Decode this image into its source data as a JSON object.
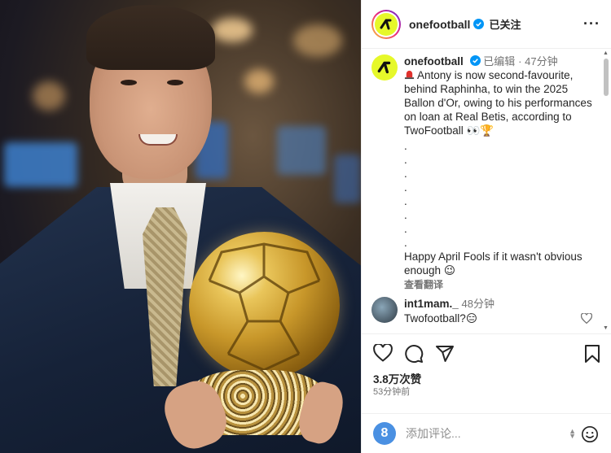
{
  "post": {
    "username": "onefootball",
    "follow_state": "已关注",
    "more": "···"
  },
  "caption": {
    "username": "onefootball",
    "edited": "已编辑",
    "separator": "·",
    "age": "47分钟",
    "text": "Antony is now second-favourite, behind Raphinha, to win the 2025 Ballon d'Or, owing to his performances on loan at Real Betis, according to TwoFootball",
    "emoji_eyes": "👀",
    "emoji_trophy": "🏆",
    "dots": [
      ".",
      ".",
      ".",
      ".",
      ".",
      ".",
      ".",
      "."
    ],
    "footer": "Happy April Fools if it wasn't obvious enough",
    "footer_emoji": "😉",
    "translate": "查看翻译"
  },
  "comments": [
    {
      "username": "int1mam._",
      "age": "48分钟",
      "text": "Twofootball?",
      "emoji": "😑"
    }
  ],
  "stats": {
    "likes": "3.8万次赞",
    "posted": "53分钟前"
  },
  "composer": {
    "avatar_letter": "8",
    "placeholder": "添加评论..."
  },
  "colors": {
    "brand_logo": "#e6f82a",
    "verified": "#0095f6"
  }
}
